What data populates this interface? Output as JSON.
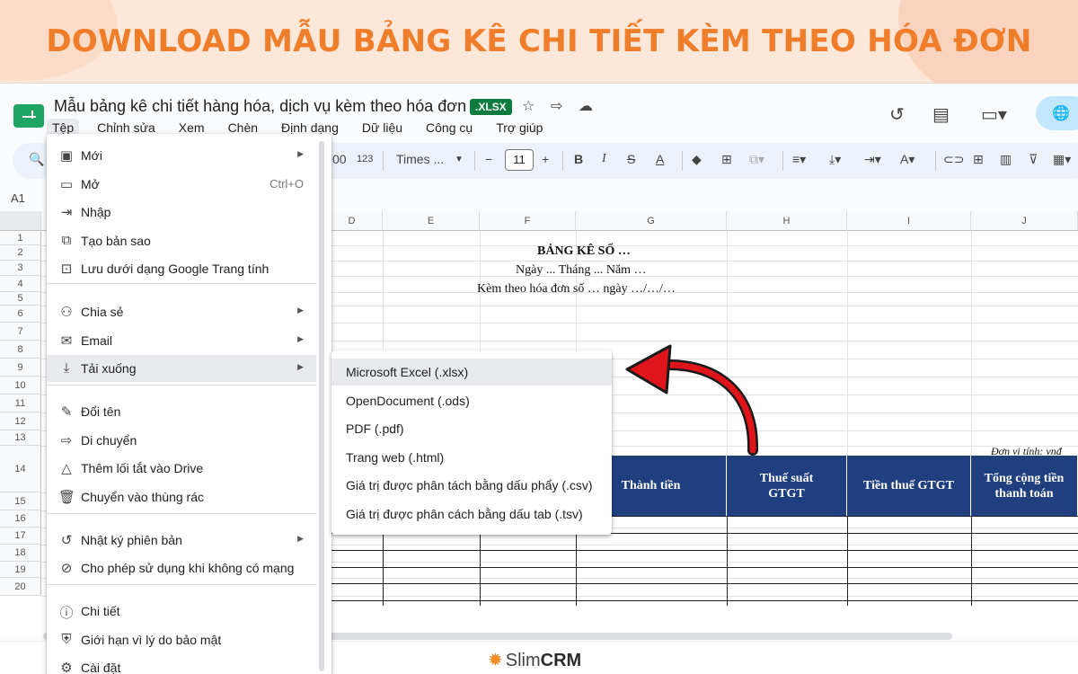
{
  "banner": {
    "title": "DOWNLOAD MẪU BẢNG KÊ CHI TIẾT KÈM THEO HÓA ĐƠN"
  },
  "app": {
    "doc_title": "Mẫu bảng kê chi tiết hàng hóa, dịch vụ kèm theo hóa đơn",
    "format_badge": ".XLSX",
    "menubar": [
      "Tệp",
      "Chỉnh sửa",
      "Xem",
      "Chèn",
      "Định dạng",
      "Dữ liệu",
      "Công cụ",
      "Trợ giúp"
    ],
    "toolbar": {
      "format_123": "123",
      "font_name": "Times ...",
      "font_size": "11",
      "percent_fragment": "00"
    },
    "cell_ref": "A1"
  },
  "grid": {
    "columns": [
      "D",
      "E",
      "F",
      "G",
      "H",
      "I",
      "J"
    ],
    "rows": [
      "1",
      "2",
      "3",
      "4",
      "5",
      "6",
      "7",
      "8",
      "9",
      "10",
      "11",
      "12",
      "13",
      "14",
      "15",
      "16",
      "17",
      "18",
      "19",
      "20"
    ],
    "doc_heading": "BẢNG KÊ SỐ …",
    "doc_date": "Ngày ... Tháng ... Năm …",
    "doc_invoice": "Kèm theo hóa đơn số … ngày …/…/…",
    "unit_note": "Đơn vị tính: vnđ",
    "table_headers": {
      "thanh_tien": "Thành tiền",
      "thue_suat_1": "Thuế suất",
      "thue_suat_2": "GTGT",
      "tien_thue": "Tiền thuế GTGT",
      "tong_cong_1": "Tổng cộng tiền",
      "tong_cong_2": "thanh toán"
    }
  },
  "file_menu": {
    "items": [
      {
        "label": "Mới",
        "icon": "new-sheet-icon",
        "has_submenu": true
      },
      {
        "label": "Mở",
        "icon": "folder-icon",
        "shortcut": "Ctrl+O"
      },
      {
        "label": "Nhập",
        "icon": "import-icon"
      },
      {
        "label": "Tạo bản sao",
        "icon": "copy-icon"
      },
      {
        "label": "Lưu dưới dạng Google Trang tính",
        "icon": "save-as-icon"
      },
      {
        "label": "Chia sẻ",
        "icon": "share-person-icon",
        "has_submenu": true
      },
      {
        "label": "Email",
        "icon": "email-icon",
        "has_submenu": true
      },
      {
        "label": "Tải xuống",
        "icon": "download-icon",
        "has_submenu": true,
        "highlighted": true
      },
      {
        "label": "Đổi tên",
        "icon": "rename-pencil-icon"
      },
      {
        "label": "Di chuyển",
        "icon": "move-folder-icon"
      },
      {
        "label": "Thêm lối tắt vào Drive",
        "icon": "drive-shortcut-icon"
      },
      {
        "label": "Chuyển vào thùng rác",
        "icon": "trash-icon"
      },
      {
        "label": "Nhật ký phiên bản",
        "icon": "history-icon",
        "has_submenu": true
      },
      {
        "label": "Cho phép sử dụng khi không có mạng",
        "icon": "offline-icon"
      },
      {
        "label": "Chi tiết",
        "icon": "info-icon"
      },
      {
        "label": "Giới hạn vì lý do bảo mật",
        "icon": "security-shield-icon"
      },
      {
        "label": "Cài đặt",
        "icon": "settings-gear-icon"
      }
    ]
  },
  "download_submenu": {
    "items": [
      {
        "label": "Microsoft Excel (.xlsx)",
        "highlighted": true
      },
      {
        "label": "OpenDocument (.ods)"
      },
      {
        "label": "PDF (.pdf)"
      },
      {
        "label": "Trang web (.html)"
      },
      {
        "label": "Giá trị được phân tách bằng dấu phẩy (.csv)"
      },
      {
        "label": "Giá trị được phân cách bằng dấu tab (.tsv)"
      }
    ]
  },
  "footer": {
    "brand_prefix": "Slim",
    "brand_suffix": "CRM"
  },
  "colors": {
    "banner_text": "#f07d2a",
    "table_header_bg": "#1f3f7f",
    "annotation_arrow": "#e0151b",
    "xlsx_badge": "#0f7b3e"
  }
}
